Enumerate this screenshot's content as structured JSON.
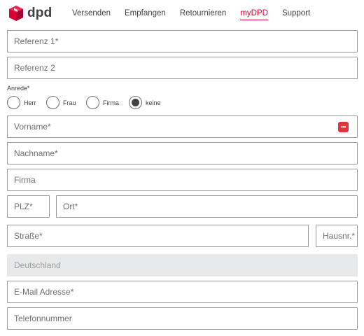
{
  "brand": {
    "name": "dpd",
    "color": "#dc0032"
  },
  "nav": {
    "items": [
      {
        "label": "Versenden"
      },
      {
        "label": "Empfangen"
      },
      {
        "label": "Retournieren"
      },
      {
        "label": "myDPD",
        "active": true
      },
      {
        "label": "Support"
      }
    ]
  },
  "form": {
    "referenz1": {
      "placeholder": "Referenz 1*"
    },
    "referenz2": {
      "placeholder": "Referenz 2"
    },
    "anrede": {
      "label": "Anrede*",
      "options": [
        {
          "label": "Herr",
          "selected": false
        },
        {
          "label": "Frau",
          "selected": false
        },
        {
          "label": "Firma",
          "selected": false
        },
        {
          "label": "keine",
          "selected": true
        }
      ]
    },
    "vorname": {
      "placeholder": "Vorname*",
      "icon": "password-manager-icon",
      "icon_glyph": "•••"
    },
    "nachname": {
      "placeholder": "Nachname*"
    },
    "firma": {
      "placeholder": "Firma"
    },
    "plz": {
      "placeholder": "PLZ*"
    },
    "ort": {
      "placeholder": "Ort*"
    },
    "strasse": {
      "placeholder": "Straße*"
    },
    "hausnr": {
      "placeholder": "Hausnr.*"
    },
    "land": {
      "value": "Deutschland",
      "disabled": true
    },
    "email": {
      "placeholder": "E-Mail Adresse*"
    },
    "telefon": {
      "placeholder": "Telefonnummer"
    }
  }
}
